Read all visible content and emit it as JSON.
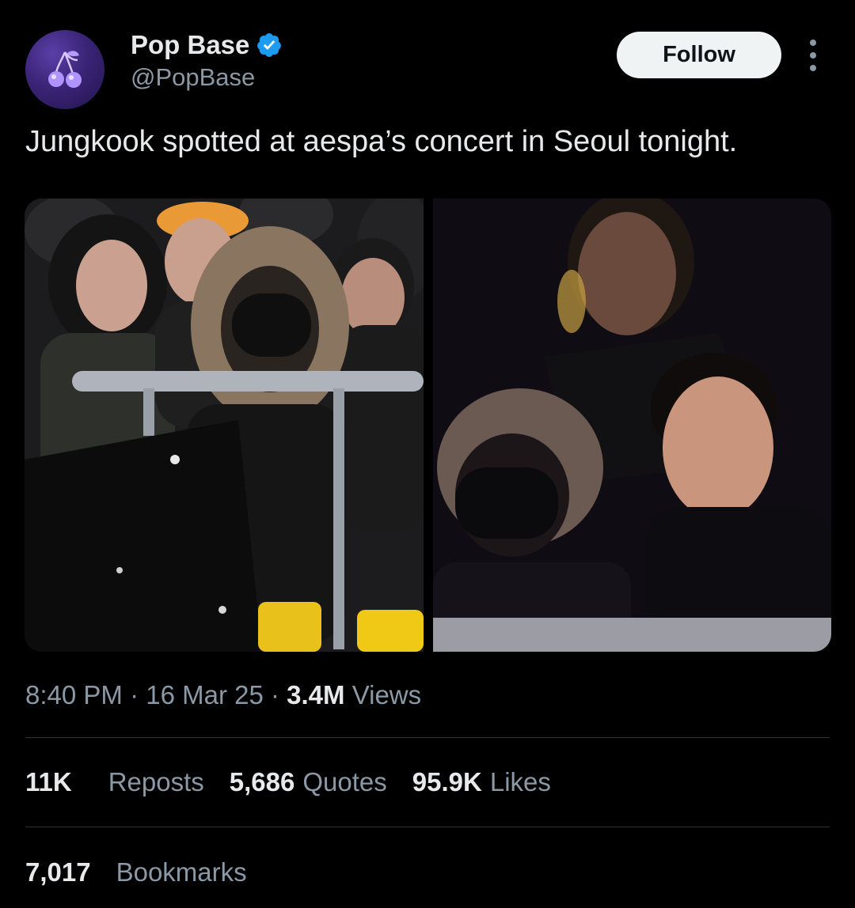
{
  "author": {
    "name": "Pop Base",
    "handle": "@PopBase",
    "avatar_icon": "cherry-icon",
    "verified": true
  },
  "follow_label": "Follow",
  "more_icon": "more-options-icon",
  "tweet": {
    "text": "Jungkook spotted at aespa’s concert in Seoul tonight."
  },
  "media": {
    "count": 2
  },
  "meta": {
    "time": "8:40 PM",
    "sep1": " · ",
    "date": "16 Mar 25",
    "sep2": " · ",
    "views_count": "3.4M",
    "views_label": " Views"
  },
  "stats": {
    "reposts_count": "11K",
    "reposts_label": "Reposts",
    "quotes_count": "5,686",
    "quotes_label": "Quotes",
    "likes_count": "95.9K",
    "likes_label": "Likes"
  },
  "bookmarks": {
    "count": "7,017",
    "label": "Bookmarks"
  },
  "colors": {
    "background": "#000000",
    "text_primary": "#e7e9ea",
    "text_secondary": "#8b98a5",
    "verified_blue": "#1d9bf0",
    "divider": "#2f3336"
  }
}
